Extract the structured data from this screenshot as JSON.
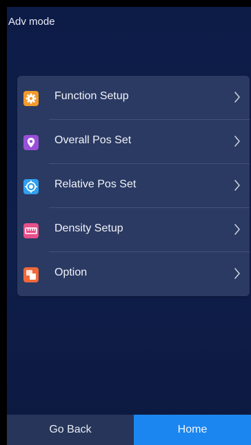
{
  "header": {
    "title": "Adv mode"
  },
  "menu": {
    "items": [
      {
        "label": "Function Setup",
        "icon": "gear-icon",
        "color": "#f39a2b"
      },
      {
        "label": "Overall Pos Set",
        "icon": "location-pin-icon",
        "color": "#9a4fd8"
      },
      {
        "label": "Relative Pos Set",
        "icon": "target-icon",
        "color": "#2fa0f2"
      },
      {
        "label": "Density Setup",
        "icon": "ruler-icon",
        "color": "#e84f8a"
      },
      {
        "label": "Option",
        "icon": "layers-icon",
        "color": "#f0683a"
      }
    ]
  },
  "footer": {
    "back_label": "Go Back",
    "home_label": "Home"
  },
  "colors": {
    "background": "#0d1b47",
    "card": "#2b3a63",
    "accent": "#1c86f0"
  }
}
